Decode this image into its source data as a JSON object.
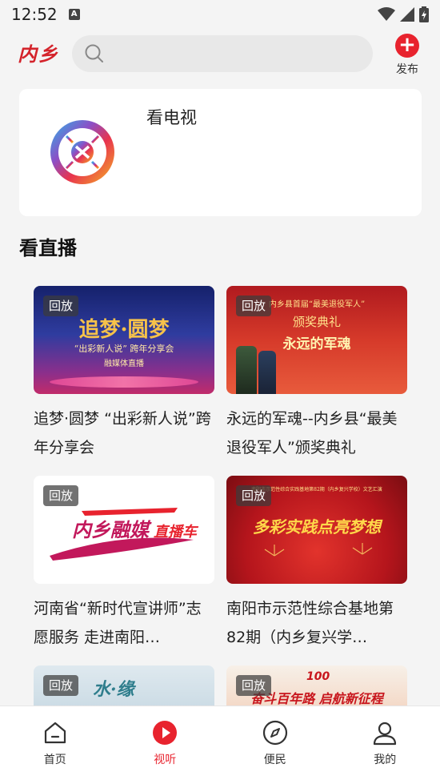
{
  "status_bar": {
    "time": "12:52",
    "notification_letter": "A"
  },
  "header": {
    "logo": "内乡",
    "search": {
      "placeholder": "",
      "value": ""
    },
    "publish_label": "发布"
  },
  "tv_card": {
    "title": "看电视"
  },
  "live_section": {
    "title": "看直播",
    "items": [
      {
        "badge": "回放",
        "title": "追梦·圆梦 “出彩新人说”跨年分享会",
        "thumb_headline": "追梦·圆梦",
        "thumb_sub": "“出彩新人说” 跨年分享会",
        "thumb_foot": "融媒体直播"
      },
      {
        "badge": "回放",
        "title": "永远的军魂--内乡县“最美退役军人”颁奖典礼",
        "thumb_headline": "颁奖典礼",
        "thumb_sub": "永远的军魂",
        "thumb_top": "内乡县首届“最美退役军人”"
      },
      {
        "badge": "回放",
        "title": "河南省“新时代宣讲师”志愿服务 走进南阳…",
        "thumb_headline": "内乡融媒",
        "thumb_sub": "直播车"
      },
      {
        "badge": "回放",
        "title": "南阳市示范性综合基地第82期（内乡复兴学…",
        "thumb_headline": "多彩实践点亮梦想",
        "thumb_top": "南阳市示范性综合实践基地第82期（内乡复兴学校）文艺汇演"
      },
      {
        "badge": "回放",
        "title": "",
        "thumb_headline": "水·缘"
      },
      {
        "badge": "回放",
        "title": "",
        "thumb_headline": "奋斗百年路 启航新征程",
        "thumb_top": "100"
      }
    ]
  },
  "bottom_nav": [
    {
      "label": "首页",
      "icon": "home-icon",
      "active": false
    },
    {
      "label": "视听",
      "icon": "play-icon",
      "active": true
    },
    {
      "label": "便民",
      "icon": "compass-icon",
      "active": false
    },
    {
      "label": "我的",
      "icon": "user-icon",
      "active": false
    }
  ],
  "colors": {
    "accent": "#e8232e",
    "background": "#f4f4f4",
    "card": "#ffffff"
  }
}
